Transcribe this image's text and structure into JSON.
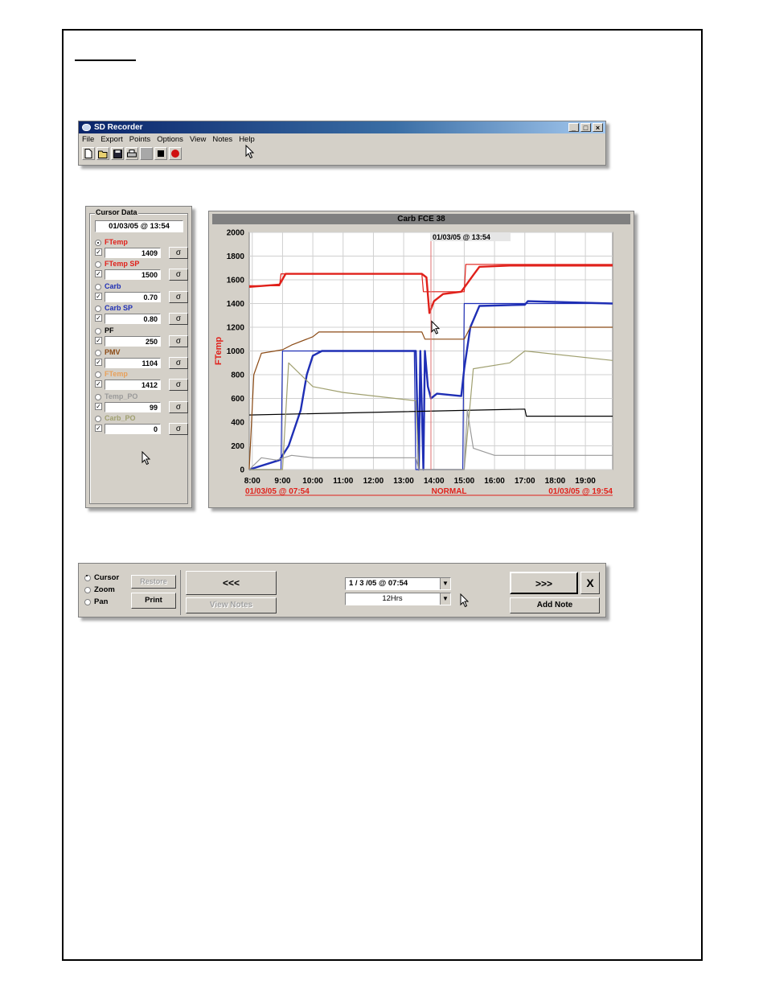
{
  "app": {
    "title": "SD Recorder",
    "menu": [
      "File",
      "Export",
      "Points",
      "Options",
      "View",
      "Notes",
      "Help"
    ],
    "toolbar_icons": [
      "new-file-icon",
      "open-folder-icon",
      "save-icon",
      "print-icon",
      "blank-icon",
      "stop-icon",
      "record-icon"
    ],
    "window_buttons": [
      "_",
      "□",
      "×"
    ]
  },
  "cursor_data": {
    "legend": "Cursor Data",
    "time": "01/03/05 @ 13:54",
    "channels": [
      {
        "name": "FTemp",
        "value": "1409",
        "color": "#e0201a",
        "selected": true,
        "checked": true
      },
      {
        "name": "FTemp SP",
        "value": "1500",
        "color": "#e0201a",
        "selected": false,
        "checked": true
      },
      {
        "name": "Carb",
        "value": "0.70",
        "color": "#1f2fb5",
        "selected": false,
        "checked": true
      },
      {
        "name": "Carb SP",
        "value": "0.80",
        "color": "#1f2fb5",
        "selected": false,
        "checked": true
      },
      {
        "name": "PF",
        "value": "250",
        "color": "#000000",
        "selected": false,
        "checked": true
      },
      {
        "name": "PMV",
        "value": "1104",
        "color": "#8b4a14",
        "selected": false,
        "checked": true
      },
      {
        "name": "FTemp",
        "value": "1412",
        "color": "#e8a05a",
        "selected": false,
        "checked": true
      },
      {
        "name": "Temp_PO",
        "value": "99",
        "color": "#9a9a9a",
        "selected": false,
        "checked": true
      },
      {
        "name": "Carb_PO",
        "value": "0",
        "color": "#a0a070",
        "selected": false,
        "checked": true
      }
    ],
    "sigma_label": "σ"
  },
  "chart": {
    "title": "Carb FCE 38",
    "cursor_label": "01/03/05 @ 13:54",
    "ylabel": "FTemp",
    "footer_left": "01/03/05 @ 07:54",
    "footer_center": "NORMAL",
    "footer_right": "01/03/05 @ 19:54"
  },
  "chart_data": {
    "type": "line",
    "title": "Carb FCE 38",
    "ylabel": "FTemp",
    "ylim": [
      0,
      2000
    ],
    "yticks": [
      0,
      200,
      400,
      600,
      800,
      1000,
      1200,
      1400,
      1600,
      1800,
      2000
    ],
    "xlim": [
      7.9,
      19.9
    ],
    "xticks": [
      "8:00",
      "9:00",
      "10:00",
      "11:00",
      "12:00",
      "13:00",
      "14:00",
      "15:00",
      "16:00",
      "17:00",
      "18:00",
      "19:00"
    ],
    "cursor_x": 13.9,
    "grid": true,
    "series": [
      {
        "color": "#e0201a",
        "x": [
          7.9,
          8.9,
          9.1,
          13.6,
          13.75,
          13.85,
          14.0,
          14.3,
          14.9,
          15.3,
          15.5,
          16.5,
          19.9
        ],
        "y": [
          1540,
          1560,
          1650,
          1650,
          1620,
          1320,
          1420,
          1480,
          1500,
          1640,
          1710,
          1720,
          1720
        ]
      },
      {
        "color": "#e0201a",
        "x": [
          7.9,
          8.9,
          8.95,
          13.6,
          13.65,
          15.0,
          15.05,
          19.9
        ],
        "y": [
          1550,
          1550,
          1650,
          1650,
          1500,
          1500,
          1730,
          1730
        ]
      },
      {
        "color": "#1f2fb5",
        "x": [
          7.9,
          8.9,
          9.2,
          9.6,
          9.8,
          10.0,
          10.3,
          13.4,
          13.5,
          13.55,
          13.65,
          13.7,
          13.8,
          13.9,
          14.1,
          14.9,
          15.0,
          15.2,
          15.5,
          17.0,
          17.1,
          19.9
        ],
        "y": [
          0,
          80,
          200,
          500,
          800,
          960,
          1000,
          1000,
          0,
          1000,
          0,
          1000,
          700,
          600,
          640,
          620,
          850,
          1200,
          1380,
          1390,
          1420,
          1400
        ]
      },
      {
        "color": "#1f2fb5",
        "x": [
          7.9,
          8.95,
          9.0,
          13.35,
          13.4,
          14.95,
          15.0,
          19.9
        ],
        "y": [
          0,
          0,
          1000,
          1000,
          0,
          0,
          1400,
          1400
        ]
      },
      {
        "color": "#000000",
        "x": [
          7.9,
          17.0,
          17.05,
          19.9
        ],
        "y": [
          460,
          510,
          450,
          450
        ]
      },
      {
        "color": "#8b4a14",
        "x": [
          7.9,
          8.05,
          8.3,
          9.0,
          9.3,
          10.0,
          10.2,
          13.6,
          13.7,
          15.0,
          15.2,
          19.9
        ],
        "y": [
          0,
          800,
          980,
          1010,
          1050,
          1120,
          1160,
          1160,
          1100,
          1100,
          1200,
          1200
        ]
      },
      {
        "color": "#a0a070",
        "x": [
          7.9,
          8.5,
          9.0,
          9.2,
          10.0,
          11.0,
          13.4,
          13.5,
          15.0,
          15.3,
          16.5,
          17.0,
          19.9
        ],
        "y": [
          0,
          0,
          0,
          900,
          700,
          650,
          580,
          0,
          0,
          850,
          900,
          1000,
          920
        ]
      },
      {
        "color": "#9a9a9a",
        "x": [
          7.9,
          8.3,
          8.8,
          9.3,
          10.0,
          13.4,
          13.5,
          15.0,
          15.1,
          15.3,
          16.0,
          19.9
        ],
        "y": [
          0,
          100,
          80,
          120,
          100,
          100,
          0,
          0,
          500,
          180,
          120,
          120
        ]
      }
    ]
  },
  "controls": {
    "modes": [
      {
        "label": "Cursor",
        "selected": true
      },
      {
        "label": "Zoom",
        "selected": false
      },
      {
        "label": "Pan",
        "selected": false
      }
    ],
    "restore_label": "Restore",
    "print_label": "Print",
    "back_label": "<<<",
    "view_notes_label": "View Notes",
    "start_time": "1 / 3 /05 @ 07:54",
    "span": "12Hrs",
    "forward_label": ">>>",
    "close_label": "X",
    "add_note_label": "Add Note"
  }
}
